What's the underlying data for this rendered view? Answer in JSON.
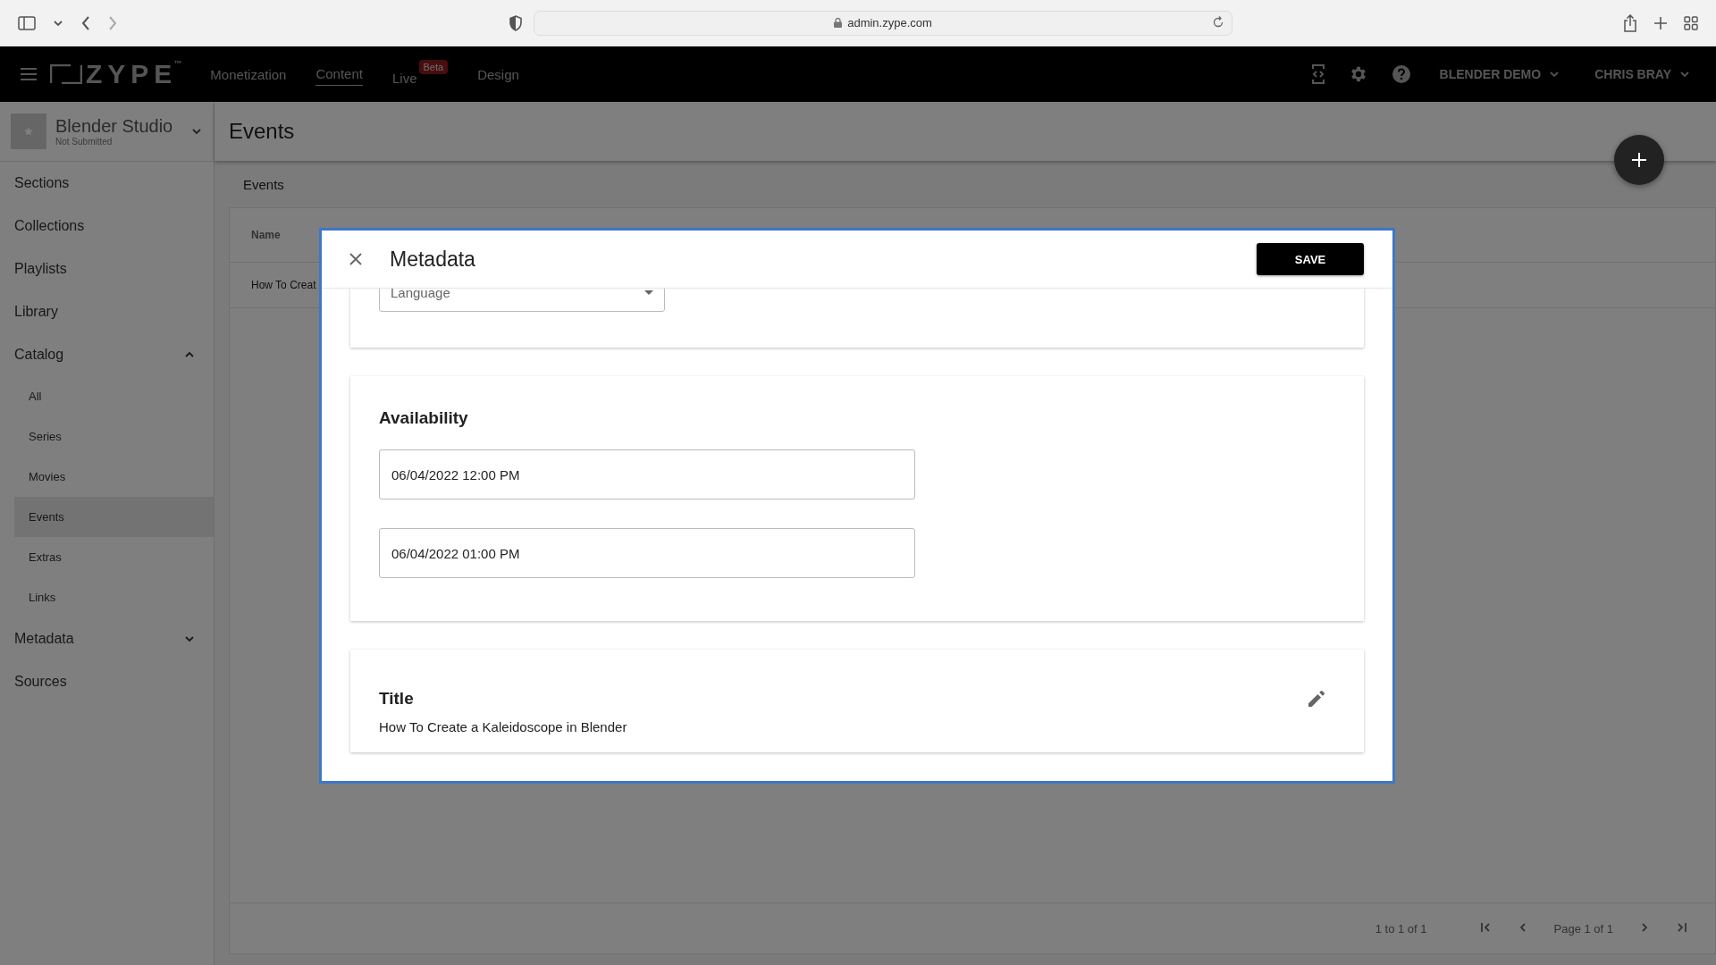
{
  "browser": {
    "url": "admin.zype.com"
  },
  "nav": {
    "logo": "ZYPE",
    "logo_mark": "™",
    "links": [
      {
        "label": "Monetization",
        "selected": false
      },
      {
        "label": "Content",
        "selected": true
      },
      {
        "label": "Live",
        "selected": false,
        "badge": "Beta"
      },
      {
        "label": "Design",
        "selected": false
      }
    ],
    "account": "BLENDER DEMO",
    "user": "CHRIS BRAY"
  },
  "sidebar": {
    "app_name": "Blender Studio",
    "app_status": "Not Submitted",
    "items": [
      {
        "kind": "link",
        "label": "Sections",
        "selected": false
      },
      {
        "kind": "link",
        "label": "Collections",
        "selected": false
      },
      {
        "kind": "link",
        "label": "Playlists",
        "selected": false
      },
      {
        "kind": "link",
        "label": "Library",
        "selected": false
      },
      {
        "kind": "group",
        "label": "Catalog",
        "selected": false,
        "expanded": true,
        "children": [
          {
            "label": "All",
            "selected": false
          },
          {
            "label": "Series",
            "selected": false
          },
          {
            "label": "Movies",
            "selected": false
          },
          {
            "label": "Events",
            "selected": true
          },
          {
            "label": "Extras",
            "selected": false
          },
          {
            "label": "Links",
            "selected": false
          }
        ]
      },
      {
        "kind": "group",
        "label": "Metadata",
        "selected": false,
        "expanded": false
      },
      {
        "kind": "link",
        "label": "Sources",
        "selected": false
      }
    ]
  },
  "page": {
    "title": "Events",
    "breadcrumb": "Events",
    "table": {
      "columns": [
        "Name"
      ],
      "rows": [
        [
          "How To Creat"
        ]
      ]
    },
    "pagination": {
      "range": "1 to 1 of 1",
      "page": "Page 1 of 1"
    }
  },
  "modal": {
    "title": "Metadata",
    "save": "SAVE",
    "language": {
      "placeholder": "Language"
    },
    "availability": {
      "heading": "Availability",
      "start": "06/04/2022 12:00 PM",
      "end": "06/04/2022 01:00 PM"
    },
    "title_card": {
      "heading": "Title",
      "value": "How To Create a Kaleidoscope in Blender"
    }
  }
}
